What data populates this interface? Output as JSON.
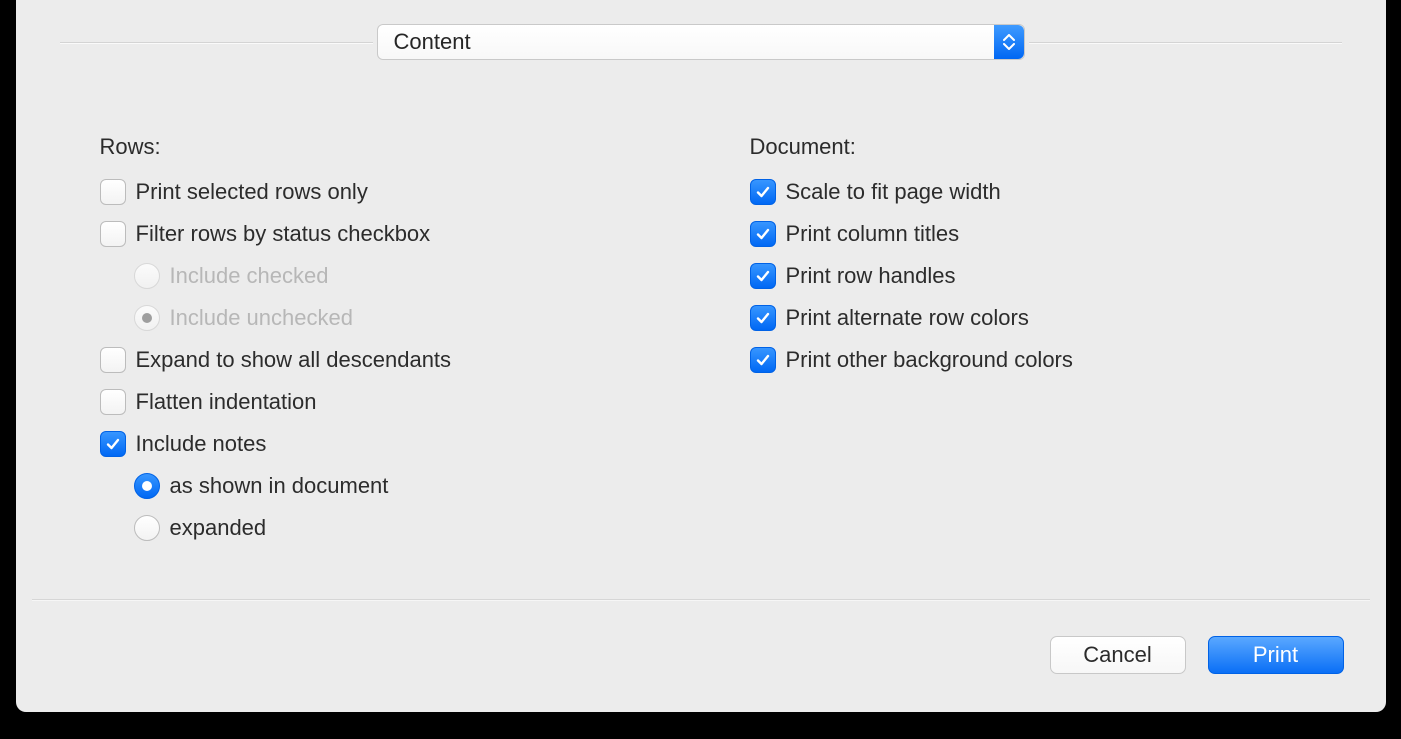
{
  "topSelect": {
    "value": "Content"
  },
  "rows": {
    "label": "Rows:",
    "printSelected": {
      "label": "Print selected rows only",
      "checked": false
    },
    "filterByStatus": {
      "label": "Filter rows by status checkbox",
      "checked": false
    },
    "includeChecked": {
      "label": "Include checked",
      "selected": false,
      "disabled": true
    },
    "includeUnchecked": {
      "label": "Include unchecked",
      "selected": true,
      "disabled": true
    },
    "expandDescendants": {
      "label": "Expand to show all descendants",
      "checked": false
    },
    "flatten": {
      "label": "Flatten indentation",
      "checked": false
    },
    "includeNotes": {
      "label": "Include notes",
      "checked": true
    },
    "notesAsShown": {
      "label": "as shown in document",
      "selected": true
    },
    "notesExpanded": {
      "label": "expanded",
      "selected": false
    }
  },
  "document": {
    "label": "Document:",
    "scaleFit": {
      "label": "Scale to fit page width",
      "checked": true
    },
    "columnTitles": {
      "label": "Print column titles",
      "checked": true
    },
    "rowHandles": {
      "label": "Print row handles",
      "checked": true
    },
    "altRowColors": {
      "label": "Print alternate row colors",
      "checked": true
    },
    "bgColors": {
      "label": "Print other background colors",
      "checked": true
    }
  },
  "footer": {
    "cancel": "Cancel",
    "print": "Print"
  }
}
